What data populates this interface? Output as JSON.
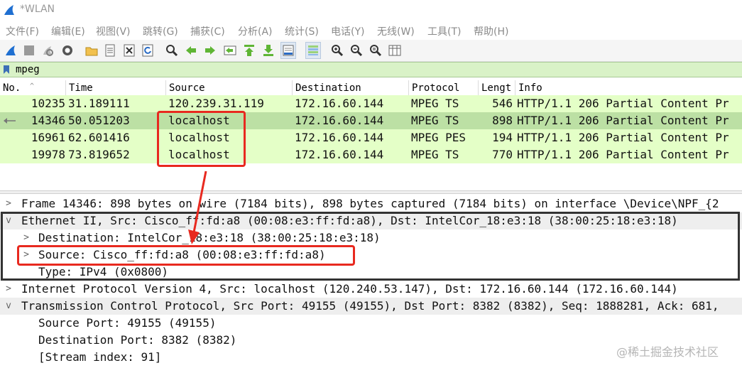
{
  "window": {
    "title": "*WLAN"
  },
  "menu": [
    "文件(F)",
    "编辑(E)",
    "视图(V)",
    "跳转(G)",
    "捕获(C)",
    "分析(A)",
    "统计(S)",
    "电话(Y)",
    "无线(W)",
    "工具(T)",
    "帮助(H)"
  ],
  "toolbar": {
    "buttons": [
      "shark-fin-icon",
      "stop-icon",
      "restart-icon",
      "options-gear-icon",
      "open-folder-icon",
      "file-icon",
      "close-file-icon",
      "reload-icon",
      "find-icon",
      "back-arrow-icon",
      "forward-arrow-icon",
      "goto-packet-icon",
      "first-packet-icon",
      "last-packet-icon",
      "autoscroll-icon",
      "colorize-icon",
      "zoom-in-icon",
      "zoom-out-icon",
      "zoom-reset-icon",
      "resize-columns-icon"
    ]
  },
  "filter": {
    "value": "mpeg"
  },
  "packet_list": {
    "columns": [
      "No.",
      "Time",
      "Source",
      "Destination",
      "Protocol",
      "Lengt",
      "Info"
    ],
    "rows": [
      {
        "no": "10235",
        "time": "31.189111",
        "source": "120.239.31.119",
        "destination": "172.16.60.144",
        "protocol": "MPEG TS",
        "length": "546",
        "info": "HTTP/1.1 206 Partial Content  Pr"
      },
      {
        "no": "14346",
        "time": "50.051203",
        "source": "localhost",
        "destination": "172.16.60.144",
        "protocol": "MPEG TS",
        "length": "898",
        "info": "HTTP/1.1 206 Partial Content  Pr"
      },
      {
        "no": "16961",
        "time": "62.601416",
        "source": "localhost",
        "destination": "172.16.60.144",
        "protocol": "MPEG PES",
        "length": "194",
        "info": "HTTP/1.1 206 Partial Content  Pr"
      },
      {
        "no": "19978",
        "time": "73.819652",
        "source": "localhost",
        "destination": "172.16.60.144",
        "protocol": "MPEG TS",
        "length": "770",
        "info": "HTTP/1.1 206 Partial Content  Pr"
      }
    ]
  },
  "details": {
    "lines": [
      {
        "caret": ">",
        "text": "Frame 14346: 898 bytes on wire (7184 bits), 898 bytes captured (7184 bits) on interface \\Device\\NPF_{2"
      },
      {
        "caret": "v",
        "text": "Ethernet II, Src: Cisco_ff:fd:a8 (00:08:e3:ff:fd:a8), Dst: IntelCor_18:e3:18 (38:00:25:18:e3:18)"
      },
      {
        "caret": ">",
        "text": "Destination: IntelCor_18:e3:18 (38:00:25:18:e3:18)"
      },
      {
        "caret": ">",
        "text": "Source: Cisco_ff:fd:a8 (00:08:e3:ff:fd:a8)"
      },
      {
        "caret": "",
        "text": "Type: IPv4 (0x0800)"
      },
      {
        "caret": ">",
        "text": "Internet Protocol Version 4, Src: localhost (120.240.53.147), Dst: 172.16.60.144 (172.16.60.144)"
      },
      {
        "caret": "v",
        "text": "Transmission Control Protocol, Src Port: 49155 (49155), Dst Port: 8382 (8382), Seq: 1888281, Ack: 681,"
      },
      {
        "caret": "",
        "text": "Source Port: 49155 (49155)"
      },
      {
        "caret": "",
        "text": "Destination Port: 8382 (8382)"
      },
      {
        "caret": "",
        "text": "[Stream index: 91]"
      }
    ]
  },
  "watermark": "@稀土掘金技术社区",
  "colors": {
    "row_bg": "#e4ffc7",
    "row_selected_bg": "#bce0a4",
    "filter_bg": "#d9f2c7",
    "annotation_red": "#e8291f",
    "box_dark": "#333333"
  }
}
